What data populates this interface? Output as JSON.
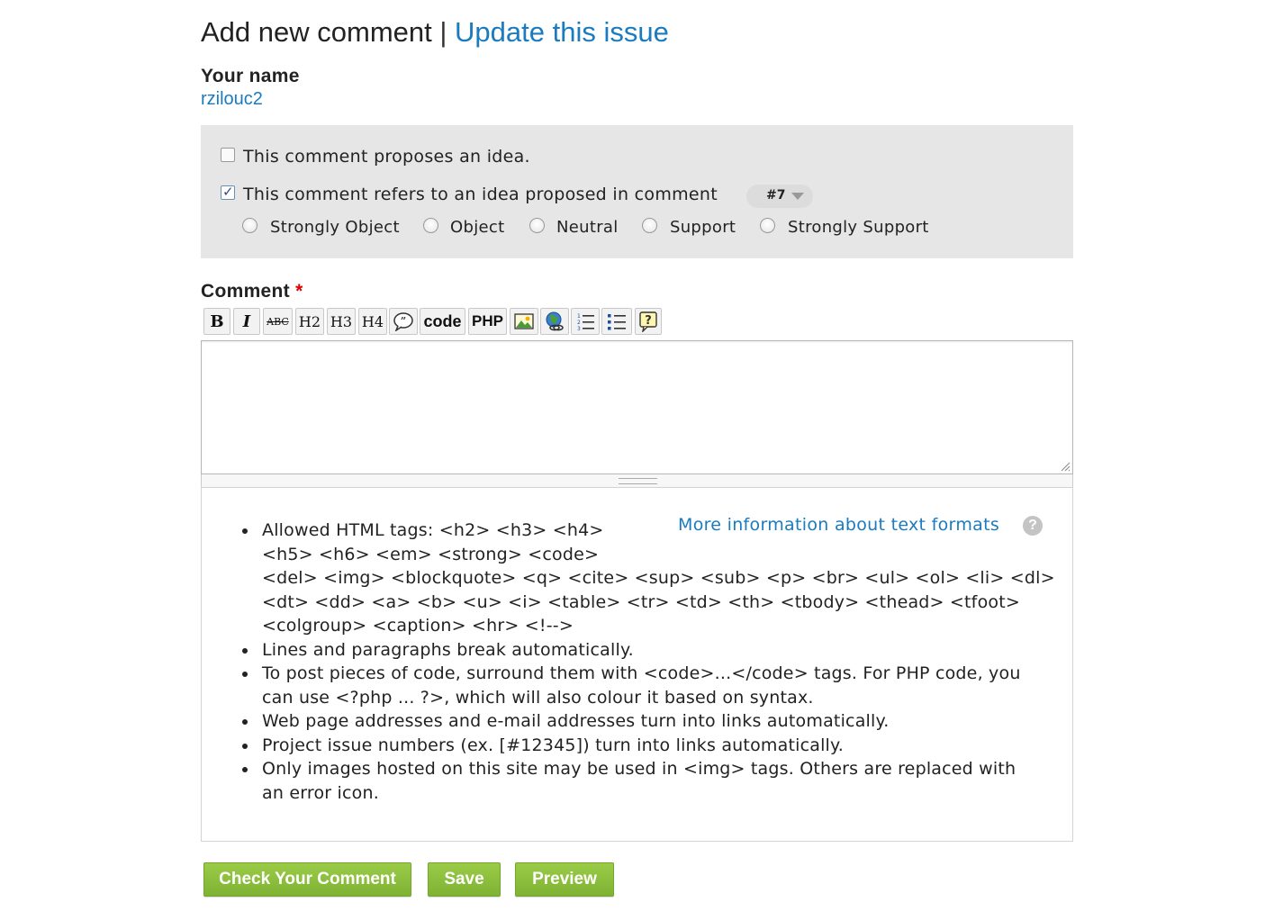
{
  "header": {
    "title": "Add new comment",
    "separator": "|",
    "update_link": "Update this issue"
  },
  "name_field": {
    "label": "Your name",
    "value": "rzilouc2"
  },
  "idea_options": {
    "proposes_label": "This comment proposes an idea.",
    "proposes_checked": false,
    "refers_label": "This comment refers to an idea proposed in comment",
    "refers_checked": true,
    "comment_select_value": "#7",
    "stances": [
      "Strongly Object",
      "Object",
      "Neutral",
      "Support",
      "Strongly Support"
    ]
  },
  "comment": {
    "label": "Comment",
    "required_marker": "*",
    "value": ""
  },
  "toolbar": {
    "bold": "B",
    "italic": "I",
    "strike": "ABC",
    "h2": "H2",
    "h3": "H3",
    "h4": "H4",
    "code": "code",
    "php": "PHP"
  },
  "text_format": {
    "more_info_link": "More information about text formats",
    "help_icon": "?",
    "tips": [
      [
        "Allowed HTML tags: <h2> <h3> <h4>",
        "<h5> <h6> <em> <strong> <code>",
        "<del> <img> <blockquote> <q> <cite> <sup> <sub> <p> <br> <ul> <ol> <li> <dl>",
        "<dt> <dd> <a> <b> <u> <i> <table> <tr> <td> <th> <tbody> <thead> <tfoot>",
        "<colgroup> <caption> <hr> <!-->"
      ],
      [
        "Lines and paragraphs break automatically."
      ],
      [
        "To post pieces of code, surround them with <code>...</code> tags. For PHP code, you",
        "can use <?php ... ?>, which will also colour it based on syntax."
      ],
      [
        "Web page addresses and e-mail addresses turn into links automatically."
      ],
      [
        "Project issue numbers (ex. [#12345]) turn into links automatically."
      ],
      [
        "Only images hosted on this site may be used in <img> tags. Others are replaced with",
        "an error icon."
      ]
    ]
  },
  "actions": {
    "check": "Check Your Comment",
    "save": "Save",
    "preview": "Preview"
  },
  "colors": {
    "link": "#1a7bbf",
    "button_green": "#8cc23f",
    "panel_gray": "#e6e6e6",
    "required_red": "#dd0000"
  }
}
